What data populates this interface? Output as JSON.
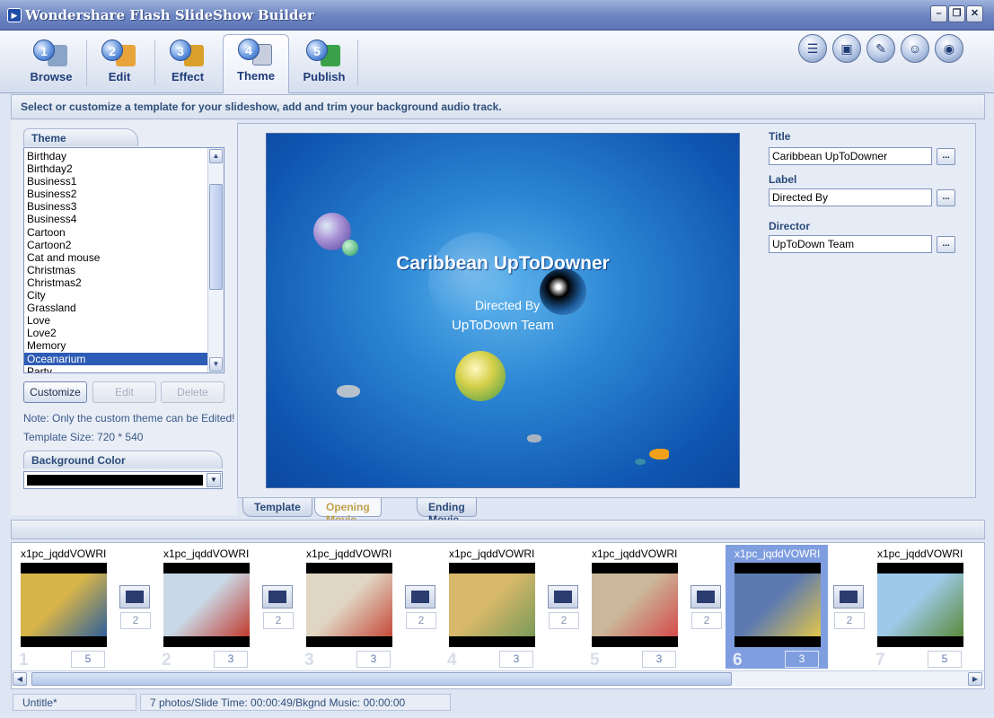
{
  "window": {
    "title": "Wondershare Flash SlideShow Builder"
  },
  "steps": [
    {
      "num": "1",
      "label": "Browse",
      "color": "#6f8fb8"
    },
    {
      "num": "2",
      "label": "Edit",
      "color": "#e8a33a"
    },
    {
      "num": "3",
      "label": "Effect",
      "color": "#d9a12b"
    },
    {
      "num": "4",
      "label": "Theme",
      "color": "#6a7fa8"
    },
    {
      "num": "5",
      "label": "Publish",
      "color": "#3aa14a"
    }
  ],
  "instruction": "Select or customize a template for your slideshow, add and trim your background audio track.",
  "theme_panel": {
    "header": "Theme",
    "items": [
      "Birthday",
      "Birthday2",
      "Business1",
      "Business2",
      "Business3",
      "Business4",
      "Cartoon",
      "Cartoon2",
      "Cat and mouse",
      "Christmas",
      "Christmas2",
      "City",
      "Grassland",
      "Love",
      "Love2",
      "Memory",
      "Oceanarium",
      "Party"
    ],
    "selected_index": 16,
    "customize_label": "Customize",
    "edit_label": "Edit",
    "delete_label": "Delete",
    "note": "Note: Only the custom theme can be Edited!",
    "template_size": "Template Size: 720 * 540",
    "bg_color_header": "Background Color",
    "bg_color_value": "#000000"
  },
  "preview": {
    "title": "Caribbean UpToDowner",
    "label": "Directed By",
    "director": "UpToDown Team"
  },
  "fields": {
    "title_label": "Title",
    "title_value": "Caribbean UpToDowner",
    "label_label": "Label",
    "label_value": "Directed By",
    "director_label": "Director",
    "director_value": "UpToDown Team",
    "dots": "..."
  },
  "tabs": [
    "Template",
    "Opening Movie",
    "Ending Movie"
  ],
  "slides": [
    {
      "name": "x1pc_jqddVOWRI",
      "num": "1",
      "duration": "5",
      "colors": [
        "#d6b44a",
        "#2f5f9a"
      ]
    },
    {
      "name": "x1pc_jqddVOWRI",
      "num": "2",
      "duration": "3",
      "colors": [
        "#c9d8e6",
        "#c23a2f"
      ]
    },
    {
      "name": "x1pc_jqddVOWRI",
      "num": "3",
      "duration": "3",
      "colors": [
        "#e0d6c4",
        "#c64a3a"
      ]
    },
    {
      "name": "x1pc_jqddVOWRI",
      "num": "4",
      "duration": "3",
      "colors": [
        "#d8b86a",
        "#7a9a5a"
      ]
    },
    {
      "name": "x1pc_jqddVOWRI",
      "num": "5",
      "duration": "3",
      "colors": [
        "#cbb89a",
        "#d44b4b"
      ]
    },
    {
      "name": "x1pc_jqddVOWRI",
      "num": "6",
      "duration": "3",
      "colors": [
        "#5d7ab0",
        "#e2c54a"
      ]
    },
    {
      "name": "x1pc_jqddVOWRI",
      "num": "7",
      "duration": "5",
      "colors": [
        "#9ec9e8",
        "#5a8a3a"
      ]
    }
  ],
  "transitions": [
    "2",
    "2",
    "2",
    "2",
    "2",
    "2"
  ],
  "status": {
    "project": "Untitle*",
    "summary": "7 photos/Slide Time: 00:00:49/Bkgnd Music: 00:00:00"
  }
}
